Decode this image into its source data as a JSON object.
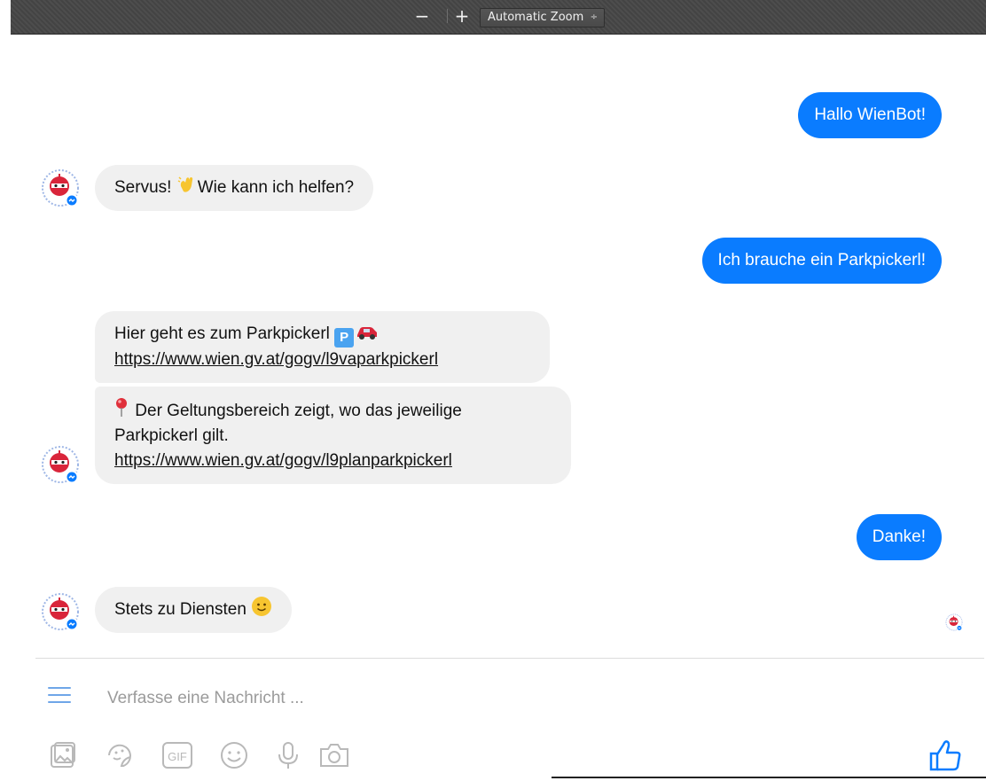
{
  "toolbar": {
    "zoom_out_label": "−",
    "zoom_in_label": "+",
    "zoom_value": "Automatic Zoom",
    "zoom_arrow": "÷"
  },
  "messages": [
    {
      "from": "user",
      "text": "Hallo WienBot!"
    },
    {
      "from": "bot",
      "text_before": "Servus! ",
      "emoji": "waving-hand",
      "text_after": "Wie kann ich helfen?"
    },
    {
      "from": "user",
      "text": "Ich brauche ein Parkpickerl!"
    },
    {
      "from": "bot",
      "line1": "Hier geht es zum Parkpickerl ",
      "emoji_parking": "P",
      "emoji_car": "car",
      "link": "https://www.wien.gv.at/gogv/l9vaparkpickerl"
    },
    {
      "from": "bot",
      "emoji": "round-pushpin",
      "line1": " Der Geltungsbereich zeigt, wo das jeweilige",
      "line2": "Parkpickerl gilt.",
      "link": "https://www.wien.gv.at/gogv/l9planparkpickerl"
    },
    {
      "from": "user",
      "text": "Danke!"
    },
    {
      "from": "bot",
      "text": "Stets zu Diensten ",
      "emoji": "slightly-smiling-face"
    }
  ],
  "composer": {
    "placeholder": "Verfasse eine Nachricht ...",
    "tools": [
      "gallery-icon",
      "sticker-icon",
      "gif-icon",
      "emoji-icon",
      "microphone-icon",
      "camera-icon"
    ],
    "gif_label": "GIF"
  },
  "colors": {
    "outgoing_bubble": "#0a7cff",
    "incoming_bubble": "#f0f0f0",
    "toolbar": "#474747",
    "icon_blue": "#6fa6e8"
  }
}
